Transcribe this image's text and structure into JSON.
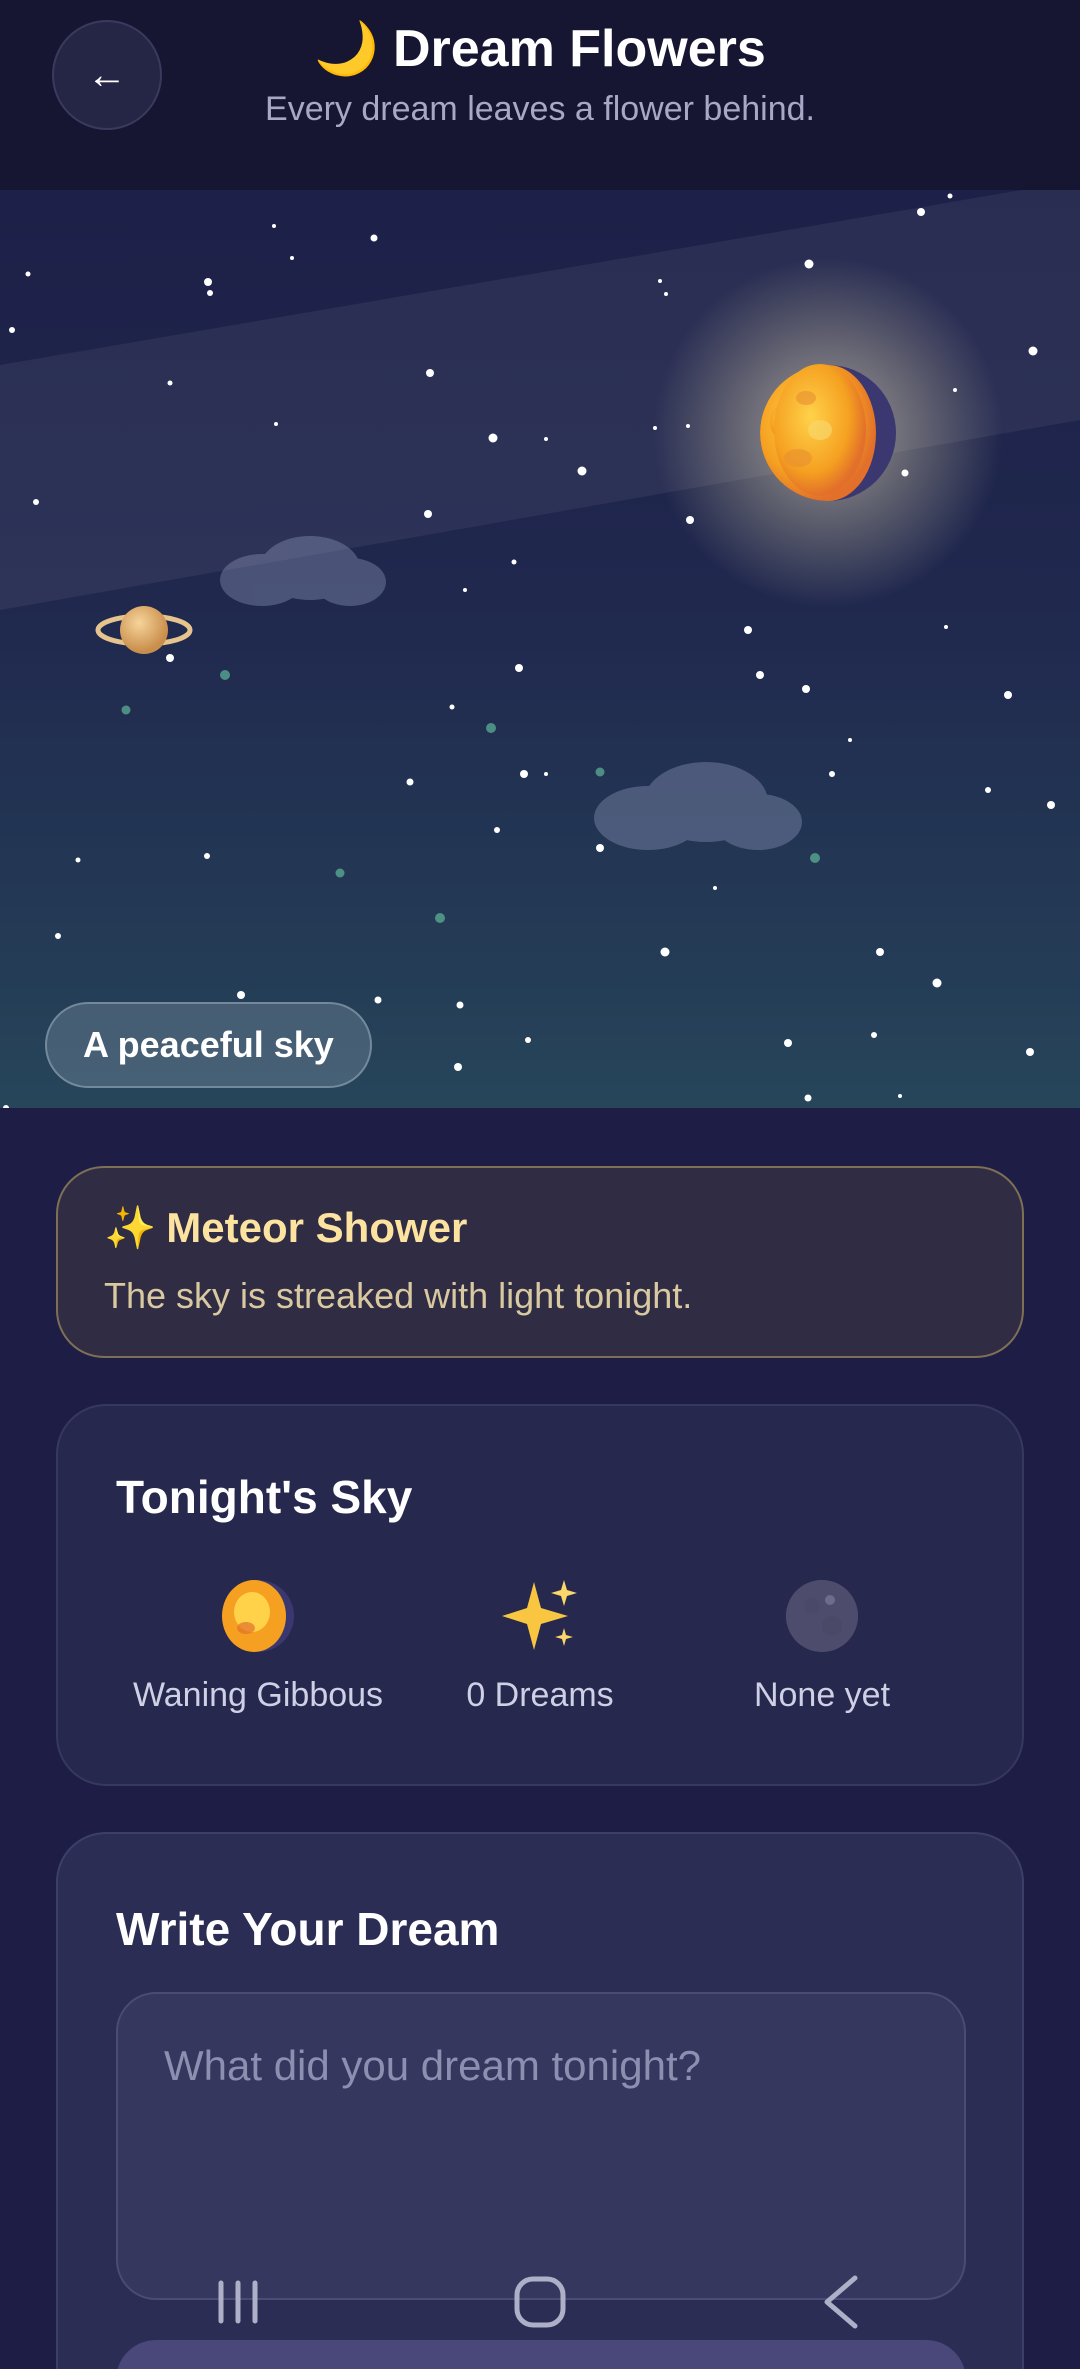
{
  "header": {
    "back_icon": "back-arrow-icon",
    "back_glyph": "←",
    "moon_glyph": "🌙",
    "title": "Dream Flowers",
    "subtitle": "Every dream leaves a flower behind."
  },
  "sky": {
    "label": "A peaceful sky",
    "moon_phase_icon": "waning-gibbous-moon-icon",
    "planet_icon": "saturn-icon"
  },
  "event": {
    "spark_glyph": "✨",
    "title": "Meteor Shower",
    "description": "The sky is streaked with light tonight."
  },
  "tonight": {
    "title": "Tonight's Sky",
    "stats": [
      {
        "icon": "waning-gibbous-moon-icon",
        "label": "Waning Gibbous"
      },
      {
        "icon": "sparkles-icon",
        "label": "0 Dreams"
      },
      {
        "icon": "new-moon-icon",
        "label": "None yet"
      }
    ]
  },
  "write": {
    "title": "Write Your Dream",
    "placeholder": "What did you dream tonight?"
  },
  "navbar": {
    "items": [
      "recent-apps-icon",
      "home-icon",
      "back-icon"
    ]
  },
  "colors": {
    "background": "#1d1d45",
    "accent_gold": "#fde3a0",
    "moon": "#f5b72a"
  }
}
